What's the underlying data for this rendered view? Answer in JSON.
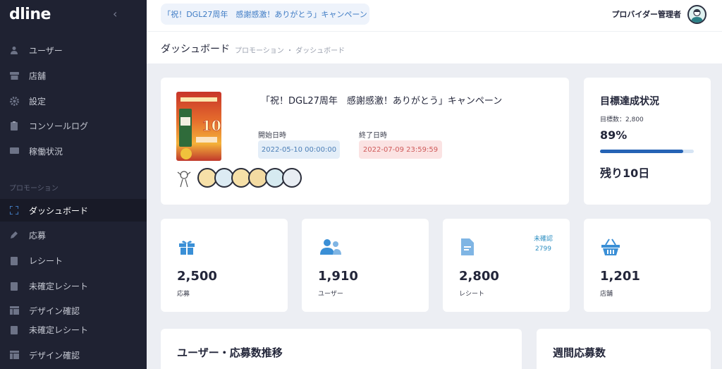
{
  "sidebar": {
    "logo": "dline",
    "collapse_icon": "chevron-left-icon",
    "items": [
      {
        "label": "ユーザー",
        "icon": "user-icon"
      },
      {
        "label": "店舗",
        "icon": "store-icon"
      },
      {
        "label": "設定",
        "icon": "gear-icon"
      },
      {
        "label": "コンソールログ",
        "icon": "clipboard-icon"
      },
      {
        "label": "稼働状況",
        "icon": "monitor-icon"
      }
    ],
    "section_title": "プロモーション",
    "promo_items": [
      {
        "label": "ダッシュボード",
        "icon": "dashboard-icon",
        "active": true
      },
      {
        "label": "応募",
        "icon": "pencil-icon"
      },
      {
        "label": "レシート",
        "icon": "receipt-icon"
      },
      {
        "label": "未確定レシート",
        "icon": "receipt-icon"
      },
      {
        "label": "デザイン確認",
        "icon": "layout-icon"
      },
      {
        "label": "未確定レシート",
        "icon": "receipt-icon"
      },
      {
        "label": "デザイン確認",
        "icon": "layout-icon"
      }
    ]
  },
  "topbar": {
    "campaign": "「祝！DGL27周年　感謝感激！ありがとう」キャンペーン",
    "user_name": "プロバイダー管理者"
  },
  "breadcrumb": {
    "title": "ダッシュボード",
    "path": "プロモーション ・ ダッシュボード"
  },
  "campaign_card": {
    "title": "「祝！DGL27周年　感謝感激！ありがとう」キャンペーン",
    "start_label": "開始日時",
    "start_value": "2022-05-10 00:00:00",
    "end_label": "終了日時",
    "end_value": "2022-07-09 23:59:59"
  },
  "goal": {
    "title": "目標達成状況",
    "target": "目標数：2,800",
    "percent": "89%",
    "progress": 0.89,
    "remaining": "残り10日"
  },
  "stats": [
    {
      "value": "2,500",
      "label": "応募",
      "icon": "gift-icon"
    },
    {
      "value": "1,910",
      "label": "ユーザー",
      "icon": "users-icon"
    },
    {
      "value": "2,800",
      "label": "レシート",
      "icon": "document-icon",
      "note_label": "未確認",
      "note_value": "2799"
    },
    {
      "value": "1,201",
      "label": "店舗",
      "icon": "basket-icon"
    }
  ],
  "bottom": {
    "trend_title": "ユーザー・応募数推移",
    "weekly_title": "週間応募数"
  },
  "colors": {
    "sidebar_bg": "#1f2232",
    "accent": "#3e7bc4",
    "progress": "#2563b5"
  }
}
